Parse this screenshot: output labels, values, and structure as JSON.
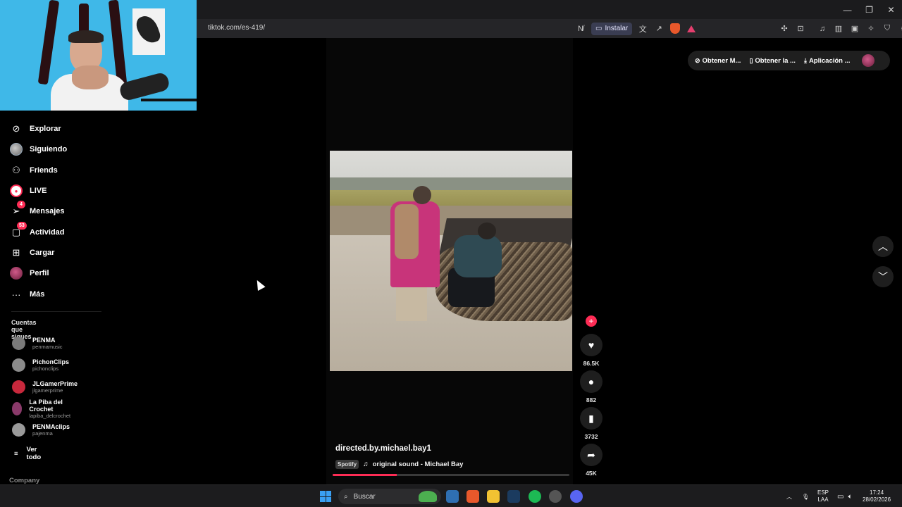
{
  "browser": {
    "url": "tiktok.com/es-419/",
    "install_label": "Instalar",
    "win_minimize": "—",
    "win_restore": "❐",
    "win_close": "✕"
  },
  "sidebar": {
    "items": [
      {
        "label": "Explorar",
        "icon": "compass-icon"
      },
      {
        "label": "Siguiendo",
        "icon": "avatar-icon"
      },
      {
        "label": "Friends",
        "icon": "friends-icon"
      },
      {
        "label": "LIVE",
        "icon": "live-icon"
      },
      {
        "label": "Mensajes",
        "icon": "messages-icon",
        "badge": "4"
      },
      {
        "label": "Actividad",
        "icon": "activity-icon",
        "badge": "53"
      },
      {
        "label": "Cargar",
        "icon": "upload-icon"
      },
      {
        "label": "Perfil",
        "icon": "profile-icon"
      },
      {
        "label": "Más",
        "icon": "more-icon"
      }
    ],
    "following_title": "Cuentas que sigues",
    "following": [
      {
        "name": "PENMA",
        "handle": "penmamusic",
        "color": "#7a7a7a"
      },
      {
        "name": "PichonClips",
        "handle": "pichonclips",
        "color": "#8b8b8b"
      },
      {
        "name": "JLGamerPrime",
        "handle": "jlgamerprime",
        "color": "#c8283c"
      },
      {
        "name": "La Piba del Crochet",
        "handle": "lapiba_delcrochet",
        "color": "#8a3a6a"
      },
      {
        "name": "PENMAclips",
        "handle": "pajenma",
        "color": "#9a9a9a"
      }
    ],
    "see_all": "Ver todo",
    "company": "Company"
  },
  "topbar": {
    "get_coins": "Obtener M...",
    "get_app": "Obtener la ...",
    "desktop_app": "Aplicación ..."
  },
  "video": {
    "author": "directed.by.michael.bay1",
    "spotify_tag": "Spotify",
    "sound": "original sound - Michael Bay",
    "progress": 0.27
  },
  "actions": {
    "likes": "86.5K",
    "comments": "882",
    "saves": "3732",
    "shares": "45K"
  },
  "taskbar": {
    "search_placeholder": "Buscar",
    "lang_top": "ESP",
    "lang_bottom": "LAA",
    "time": "17:24",
    "date": "28/02/2026"
  },
  "colors": {
    "accent": "#fe2c55",
    "background": "#000000",
    "windows_blue": "#3aa0f3"
  }
}
